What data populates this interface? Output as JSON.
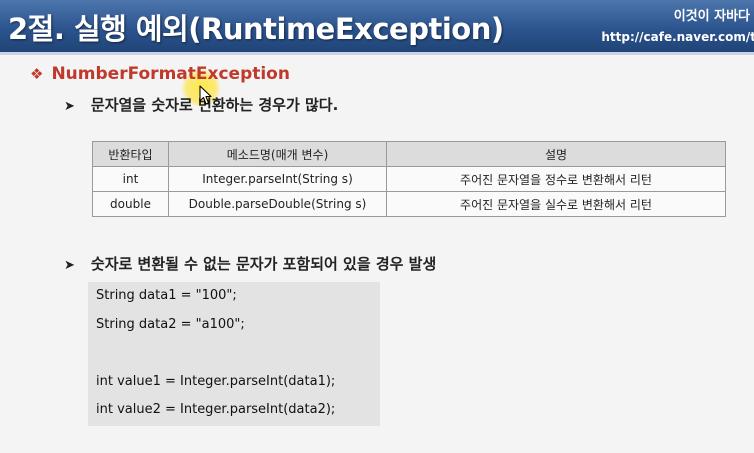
{
  "header": {
    "title": "2절. 실행 예외(RuntimeException)",
    "brand_name": "이것이 자바다",
    "brand_url": "http://cafe.naver.com/t"
  },
  "section": {
    "bullet_icon": "diamond-icon",
    "title": "NumberFormatException"
  },
  "points": [
    "문자열을 숫자로 변환하는 경우가 많다.",
    "숫자로 변환될 수 없는 문자가 포함되어 있을 경우 발생"
  ],
  "table": {
    "headers": [
      "반환타입",
      "메소드명(매개 변수)",
      "설명"
    ],
    "rows": [
      [
        "int",
        "Integer.parseInt(String s)",
        "주어진 문자열을 정수로 변환해서 리턴"
      ],
      [
        "double",
        "Double.parseDouble(String s)",
        "주어진 문자열을 실수로 변환해서 리턴"
      ]
    ]
  },
  "code": [
    "String data1 = \"100\";",
    "String data2 = \"a100\";",
    "",
    "int value1 = Integer.parseInt(data1);",
    "int value2 = Integer.parseInt(data2);"
  ],
  "colors": {
    "header_blue": "#2c548e",
    "accent_red": "#c0392b",
    "cursor_highlight": "#ffe93c"
  }
}
